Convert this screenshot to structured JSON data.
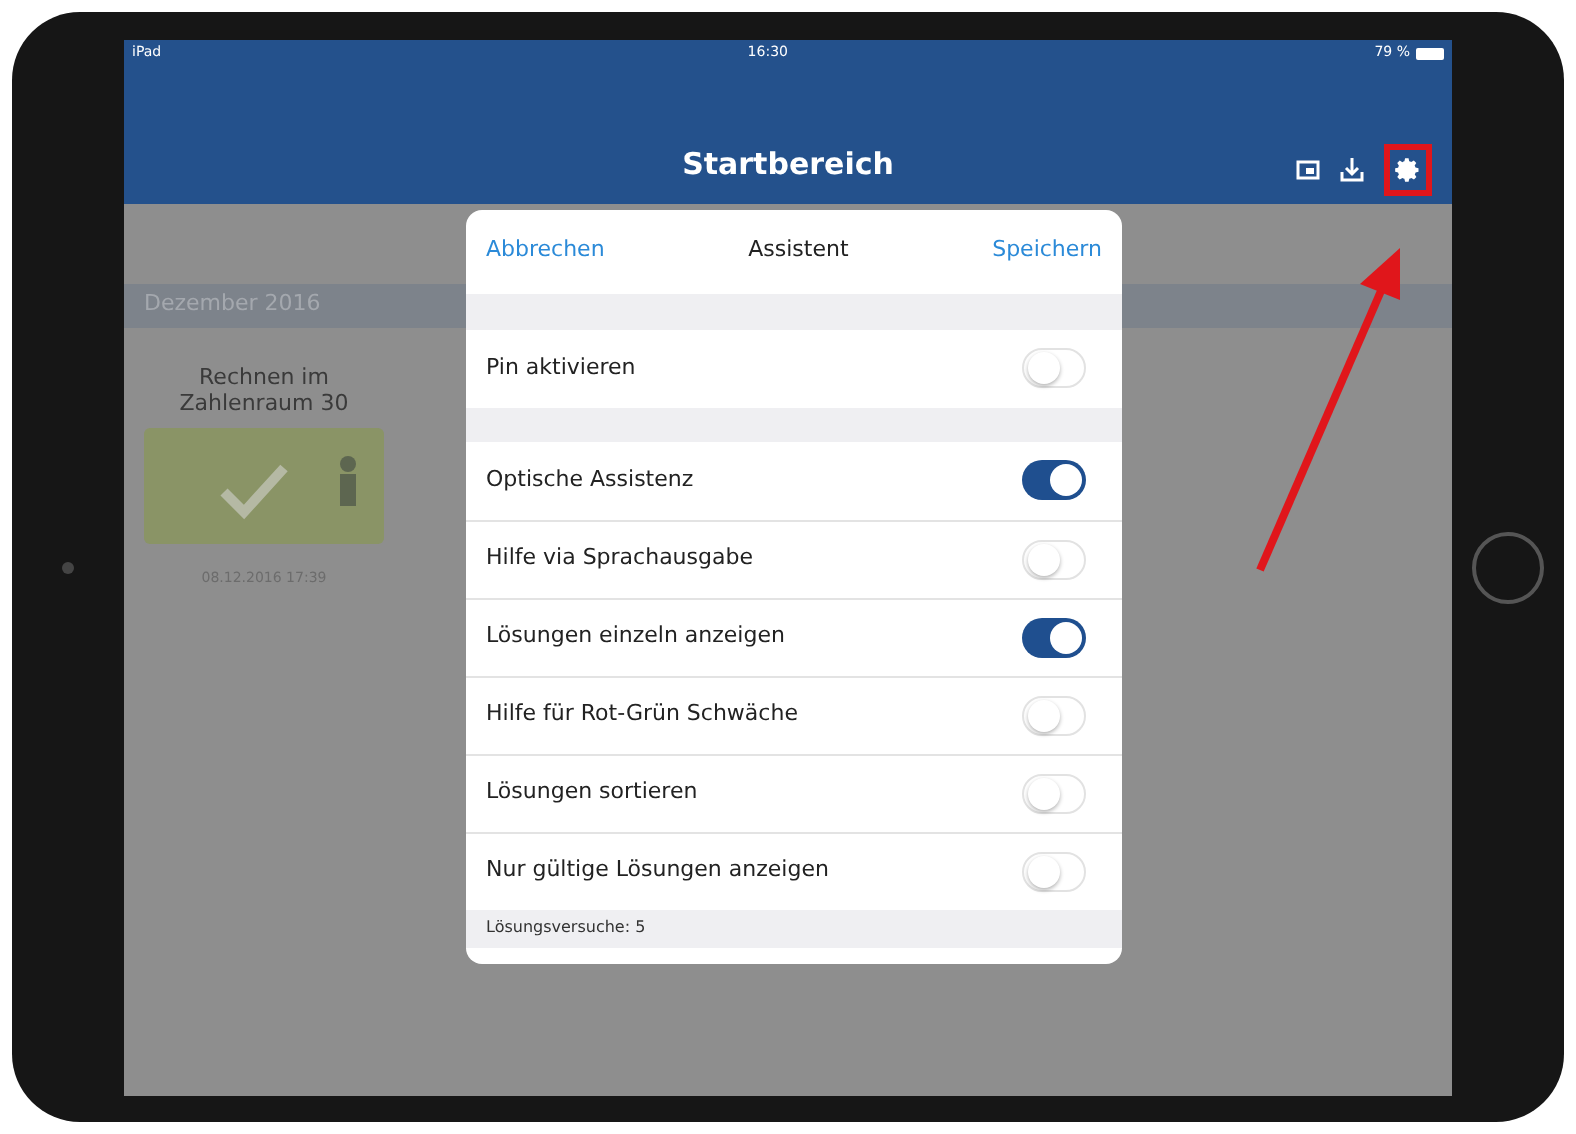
{
  "status_bar": {
    "device": "iPad",
    "time": "16:30",
    "battery": "79 %"
  },
  "nav": {
    "title": "Startbereich",
    "settings_highlighted": true
  },
  "background": {
    "section": "Dezember 2016",
    "card": {
      "title": "Rechnen im Zahlenraum 30",
      "date": "08.12.2016 17:39"
    }
  },
  "dialog": {
    "cancel": "Abbrechen",
    "title": "Assistent",
    "save": "Speichern",
    "groups": [
      [
        {
          "label": "Pin aktivieren",
          "on": false
        }
      ],
      [
        {
          "label": "Optische Assistenz",
          "on": true
        },
        {
          "label": "Hilfe via Sprachausgabe",
          "on": false
        },
        {
          "label": "Lösungen einzeln anzeigen",
          "on": true
        },
        {
          "label": "Hilfe für Rot-Grün Schwäche",
          "on": false
        },
        {
          "label": "Lösungen sortieren",
          "on": false
        },
        {
          "label": "Nur gültige Lösungen anzeigen",
          "on": false
        }
      ]
    ],
    "footer": "Lösungsversuche: 5"
  }
}
